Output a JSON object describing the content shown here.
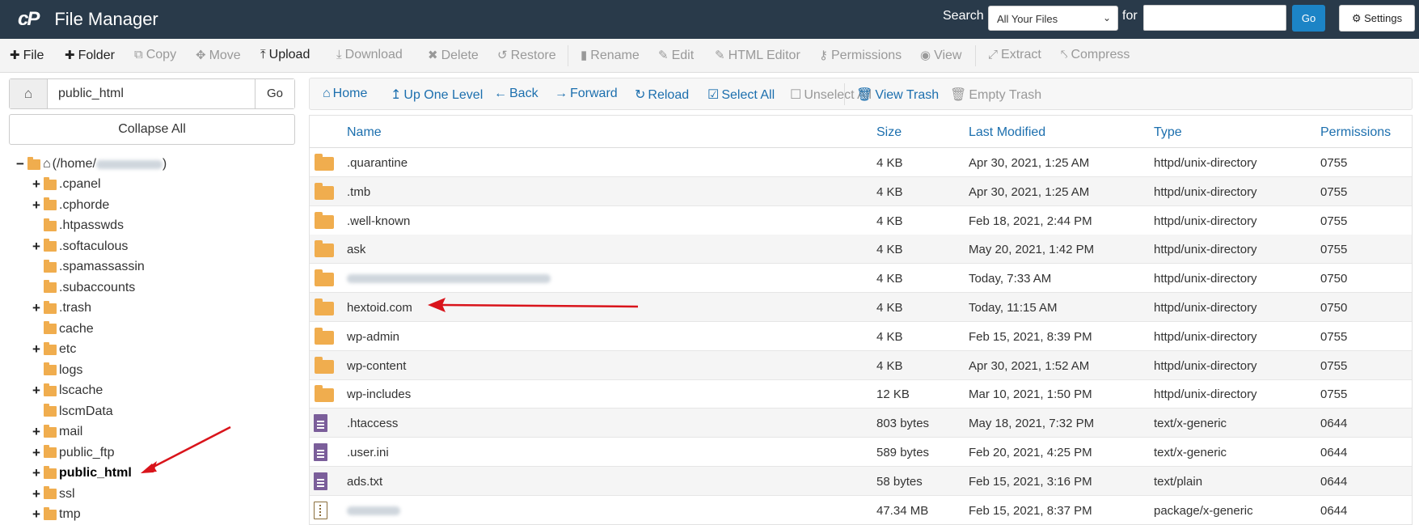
{
  "header": {
    "logo": "cP",
    "title": "File Manager",
    "search_label": "Search",
    "search_scope": "All Your Files",
    "for_label": "for",
    "search_value": "",
    "go_label": "Go",
    "settings_label": "Settings"
  },
  "toolbar": {
    "file": "File",
    "folder": "Folder",
    "copy": "Copy",
    "move": "Move",
    "upload": "Upload",
    "download": "Download",
    "delete": "Delete",
    "restore": "Restore",
    "rename": "Rename",
    "edit": "Edit",
    "html_editor": "HTML Editor",
    "permissions": "Permissions",
    "view": "View",
    "extract": "Extract",
    "compress": "Compress"
  },
  "sidebar": {
    "path_value": "public_html",
    "path_go": "Go",
    "collapse_all": "Collapse All",
    "root_label": "(/home/",
    "root_suffix": ")",
    "items": [
      {
        "label": ".cpanel",
        "expandable": true
      },
      {
        "label": ".cphorde",
        "expandable": true
      },
      {
        "label": ".htpasswds",
        "expandable": false
      },
      {
        "label": ".softaculous",
        "expandable": true
      },
      {
        "label": ".spamassassin",
        "expandable": false
      },
      {
        "label": ".subaccounts",
        "expandable": false
      },
      {
        "label": ".trash",
        "expandable": true
      },
      {
        "label": "cache",
        "expandable": false
      },
      {
        "label": "etc",
        "expandable": true
      },
      {
        "label": "logs",
        "expandable": false
      },
      {
        "label": "lscache",
        "expandable": true
      },
      {
        "label": "lscmData",
        "expandable": false
      },
      {
        "label": "mail",
        "expandable": true
      },
      {
        "label": "public_ftp",
        "expandable": true
      },
      {
        "label": "public_html",
        "expandable": true,
        "selected": true
      },
      {
        "label": "ssl",
        "expandable": true
      },
      {
        "label": "tmp",
        "expandable": true
      }
    ]
  },
  "nav": {
    "home": "Home",
    "up_one_level": "Up One Level",
    "back": "Back",
    "forward": "Forward",
    "reload": "Reload",
    "select_all": "Select All",
    "unselect_all": "Unselect All",
    "view_trash": "View Trash",
    "empty_trash": "Empty Trash"
  },
  "table": {
    "headers": {
      "name": "Name",
      "size": "Size",
      "modified": "Last Modified",
      "type": "Type",
      "permissions": "Permissions"
    },
    "rows": [
      {
        "icon": "folder",
        "name": ".quarantine",
        "size": "4 KB",
        "modified": "Apr 30, 2021, 1:25 AM",
        "type": "httpd/unix-directory",
        "perms": "0755"
      },
      {
        "icon": "folder",
        "name": ".tmb",
        "size": "4 KB",
        "modified": "Apr 30, 2021, 1:25 AM",
        "type": "httpd/unix-directory",
        "perms": "0755"
      },
      {
        "icon": "folder",
        "name": ".well-known",
        "size": "4 KB",
        "modified": "Feb 18, 2021, 2:44 PM",
        "type": "httpd/unix-directory",
        "perms": "0755"
      },
      {
        "icon": "folder",
        "name": "ask",
        "size": "4 KB",
        "modified": "May 20, 2021, 1:42 PM",
        "type": "httpd/unix-directory",
        "perms": "0755"
      },
      {
        "icon": "folder",
        "name": "",
        "size": "4 KB",
        "modified": "Today, 7:33 AM",
        "type": "httpd/unix-directory",
        "perms": "0750"
      },
      {
        "icon": "folder",
        "name": "hextoid.com",
        "size": "4 KB",
        "modified": "Today, 11:15 AM",
        "type": "httpd/unix-directory",
        "perms": "0750"
      },
      {
        "icon": "folder",
        "name": "wp-admin",
        "size": "4 KB",
        "modified": "Feb 15, 2021, 8:39 PM",
        "type": "httpd/unix-directory",
        "perms": "0755"
      },
      {
        "icon": "folder",
        "name": "wp-content",
        "size": "4 KB",
        "modified": "Apr 30, 2021, 1:52 AM",
        "type": "httpd/unix-directory",
        "perms": "0755"
      },
      {
        "icon": "folder",
        "name": "wp-includes",
        "size": "12 KB",
        "modified": "Mar 10, 2021, 1:50 PM",
        "type": "httpd/unix-directory",
        "perms": "0755"
      },
      {
        "icon": "document",
        "name": ".htaccess",
        "size": "803 bytes",
        "modified": "May 18, 2021, 7:32 PM",
        "type": "text/x-generic",
        "perms": "0644"
      },
      {
        "icon": "document",
        "name": ".user.ini",
        "size": "589 bytes",
        "modified": "Feb 20, 2021, 4:25 PM",
        "type": "text/x-generic",
        "perms": "0644"
      },
      {
        "icon": "document",
        "name": "ads.txt",
        "size": "58 bytes",
        "modified": "Feb 15, 2021, 3:16 PM",
        "type": "text/plain",
        "perms": "0644"
      },
      {
        "icon": "archive",
        "name": "",
        "size": "47.34 MB",
        "modified": "Feb 15, 2021, 8:37 PM",
        "type": "package/x-generic",
        "perms": "0644"
      }
    ]
  },
  "colors": {
    "header_bg": "#293a4a",
    "accent": "#1c6fae",
    "button_blue": "#1c84c6",
    "folder": "#f0ad4e",
    "arrow": "#d9141b"
  }
}
